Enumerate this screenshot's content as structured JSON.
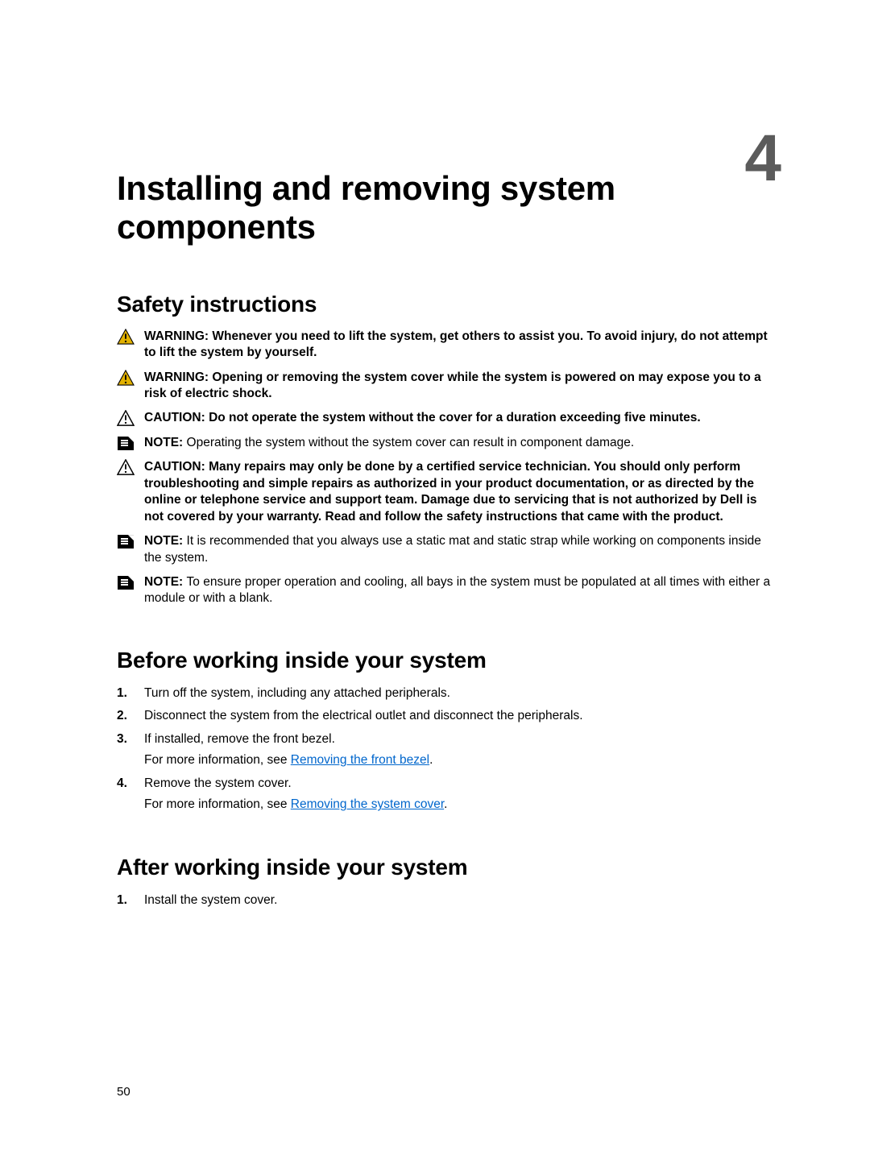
{
  "chapter_number": "4",
  "title": "Installing and removing system components",
  "sections": {
    "safety": {
      "heading": "Safety instructions",
      "items": [
        {
          "type": "warning",
          "lead": "WARNING: ",
          "body": "Whenever you need to lift the system, get others to assist you. To avoid injury, do not attempt to lift the system by yourself."
        },
        {
          "type": "warning",
          "lead": "WARNING: ",
          "body": "Opening or removing the system cover while the system is powered on may expose you to a risk of electric shock."
        },
        {
          "type": "caution",
          "lead": "CAUTION: ",
          "body": "Do not operate the system without the cover for a duration exceeding five minutes."
        },
        {
          "type": "note",
          "lead": "NOTE: ",
          "body": "Operating the system without the system cover can result in component damage."
        },
        {
          "type": "caution",
          "lead": "CAUTION: ",
          "body": "Many repairs may only be done by a certified service technician. You should only perform troubleshooting and simple repairs as authorized in your product documentation, or as directed by the online or telephone service and support team. Damage due to servicing that is not authorized by Dell is not covered by your warranty. Read and follow the safety instructions that came with the product."
        },
        {
          "type": "note",
          "lead": "NOTE: ",
          "body": "It is recommended that you always use a static mat and static strap while working on components inside the system."
        },
        {
          "type": "note",
          "lead": "NOTE: ",
          "body": "To ensure proper operation and cooling, all bays in the system must be populated at all times with either a module or with a blank."
        }
      ]
    },
    "before": {
      "heading": "Before working inside your system",
      "steps": [
        {
          "text": "Turn off the system, including any attached peripherals."
        },
        {
          "text": "Disconnect the system from the electrical outlet and disconnect the peripherals."
        },
        {
          "text": "If installed, remove the front bezel.",
          "sub_prefix": "For more information, see ",
          "sub_link": "Removing the front bezel",
          "sub_suffix": "."
        },
        {
          "text": "Remove the system cover.",
          "sub_prefix": "For more information, see ",
          "sub_link": "Removing the system cover",
          "sub_suffix": "."
        }
      ]
    },
    "after": {
      "heading": "After working inside your system",
      "steps": [
        {
          "text": "Install the system cover."
        }
      ]
    }
  },
  "page_number": "50"
}
